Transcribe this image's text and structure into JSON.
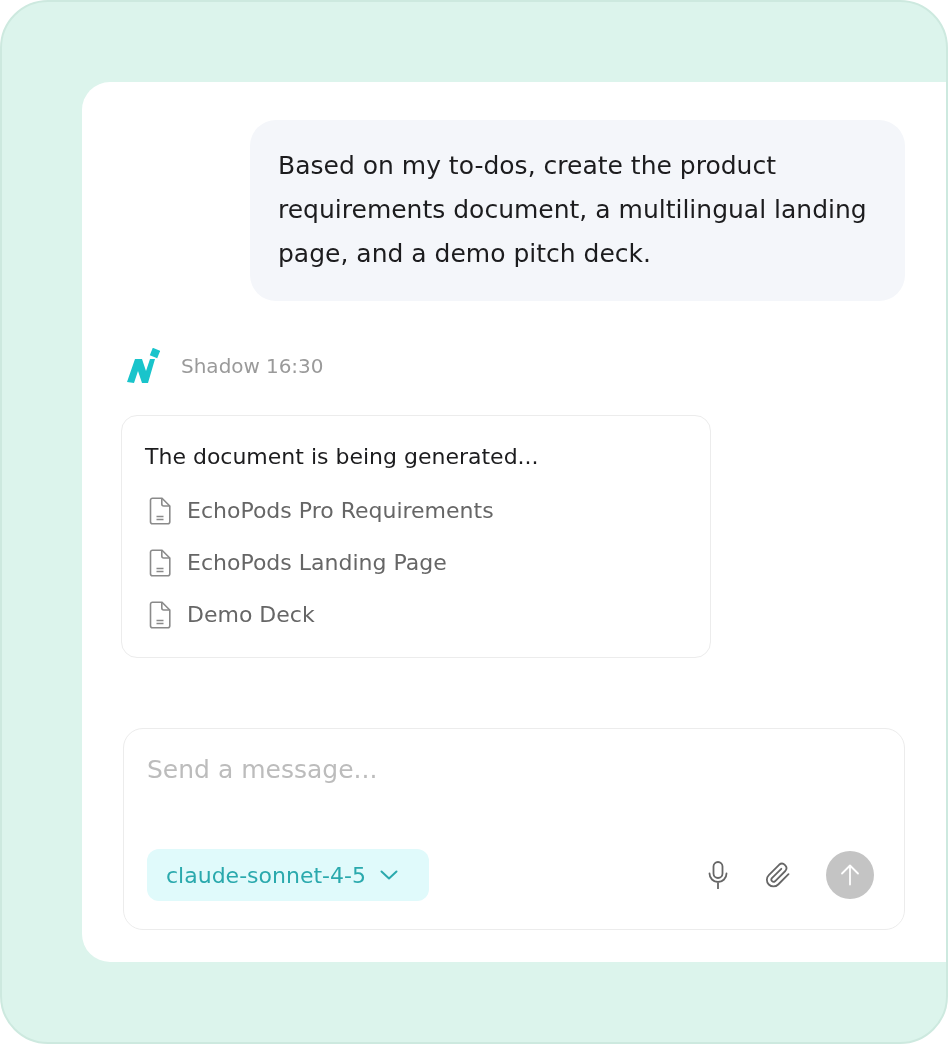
{
  "conversation": {
    "user_message": {
      "text": "Based on my to-dos, create the product requirements document, a multilingual landing page, and a demo pitch deck."
    },
    "reply": {
      "sender": "Shadow",
      "time": "16:30",
      "status": "The document is being generated...",
      "documents": [
        {
          "title": "EchoPods Pro Requirements"
        },
        {
          "title": "EchoPods Landing Page"
        },
        {
          "title": "Demo Deck"
        }
      ]
    }
  },
  "composer": {
    "placeholder": "Send a message...",
    "model": "claude-sonnet-4-5",
    "send_button": {
      "disabled": true
    }
  }
}
